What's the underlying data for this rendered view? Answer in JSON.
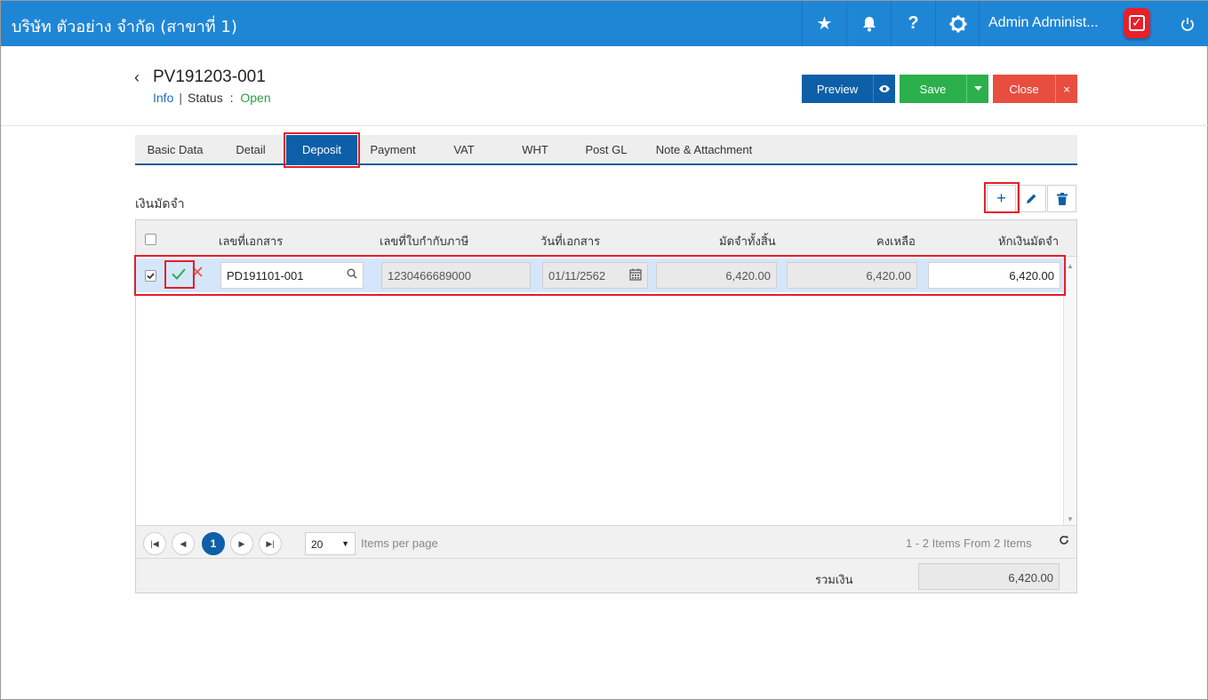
{
  "topbar": {
    "company": "บริษัท ตัวอย่าง จำกัด (สาขาที่ 1)",
    "user": "Admin Administ...",
    "icons": [
      "star-icon",
      "bell-icon",
      "help-icon",
      "gear-icon",
      "power-icon"
    ],
    "help_glyph": "?"
  },
  "header": {
    "doc_no": "PV191203-001",
    "info": "Info",
    "separator": "|",
    "status_label": "Status",
    "status_colon": ":",
    "status_value": "Open",
    "status_color": "#27a04b"
  },
  "actions": {
    "preview": "Preview",
    "save": "Save",
    "close": "Close",
    "close_x": "×"
  },
  "tabs": [
    "Basic Data",
    "Detail",
    "Deposit",
    "Payment",
    "VAT",
    "WHT",
    "Post GL",
    "Note & Attachment"
  ],
  "active_tab": "Deposit",
  "section": {
    "title": "เงินมัดจำ",
    "add": "+"
  },
  "grid": {
    "columns": [
      "เลขที่เอกสาร",
      "เลขที่ใบกำกับภาษี",
      "วันที่เอกสาร",
      "มัดจำทั้งสิ้น",
      "คงเหลือ",
      "หักเงินมัดจำ"
    ],
    "row": {
      "checked": true,
      "doc_no": "PD191101-001",
      "tax_invoice_no": "1230466689000",
      "doc_date": "01/11/2562",
      "deposit_total": "6,420.00",
      "remaining": "6,420.00",
      "deduct": "6,420.00"
    }
  },
  "pager": {
    "page": "1",
    "page_size": "20",
    "items_per_page": "Items per page",
    "summary": "1 - 2 Items From 2 Items"
  },
  "totals": {
    "label": "รวมเงิน",
    "value": "6,420.00"
  },
  "colors": {
    "topbar": "#1f86d6",
    "primary": "#0d5fa8",
    "save": "#2bb04b",
    "close": "#e84e40",
    "highlight": "#e2202a"
  }
}
